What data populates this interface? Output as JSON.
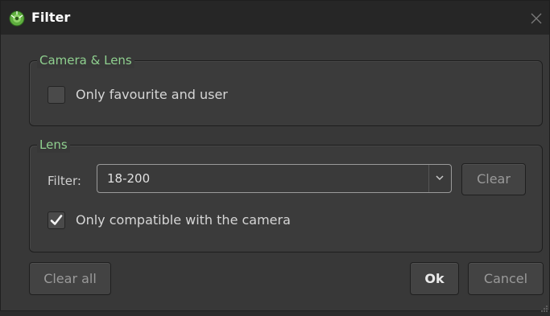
{
  "window": {
    "title": "Filter",
    "icon": "app-logo-icon",
    "close_icon": "close-icon"
  },
  "camera_lens_group": {
    "legend": "Camera & Lens",
    "favourite_checkbox": {
      "label": "Only favourite and user",
      "checked": false
    }
  },
  "lens_group": {
    "legend": "Lens",
    "filter_label": "Filter:",
    "filter_combo": {
      "value": "18-200"
    },
    "clear_label": "Clear",
    "compatible_checkbox": {
      "label": "Only compatible with the camera",
      "checked": true
    }
  },
  "footer": {
    "clear_all_label": "Clear all",
    "ok_label": "Ok",
    "cancel_label": "Cancel"
  },
  "colors": {
    "accent_green": "#8fd08f",
    "background": "#383838",
    "titlebar": "#262626"
  }
}
